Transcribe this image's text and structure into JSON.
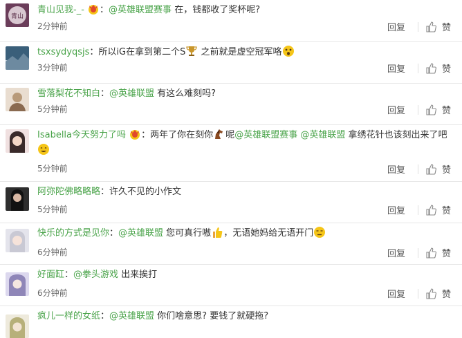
{
  "actions": {
    "reply_label": "回复",
    "like_label": "赞"
  },
  "comments": [
    {
      "user": "青山见我-_-",
      "mention1": "@英雄联盟赛事",
      "text1": " 在，钱都收了奖杯呢?",
      "time": "2分钟前",
      "avatar_color": "#6b3d5a"
    },
    {
      "user": "tsxsydyqsjs",
      "text1": "所以iG在拿到第二个S",
      "text2": " 之前就是虚空冠军咯",
      "time": "3分钟前",
      "avatar_color": "#3a5f7a"
    },
    {
      "user": "雪落梨花不知白",
      "mention1": "@英雄联盟",
      "text1": " 有这么难刻吗?",
      "time": "5分钟前",
      "avatar_color": "#b89a7a"
    },
    {
      "user": "Isabella今天努力了吗",
      "text1": "两年了你在刻你",
      "text2": "呢",
      "mention1": "@英雄联盟赛事",
      "mention2": "@英雄联盟",
      "text3": " 拿绣花针也该刻出来了吧",
      "time": "5分钟前",
      "avatar_color": "#8a5a5a"
    },
    {
      "user": "阿弥陀佛略略略",
      "text1": "许久不见的小作文",
      "time": "5分钟前",
      "avatar_color": "#2e2e2e"
    },
    {
      "user": "快乐的方式是见你",
      "mention1": "@英雄联盟",
      "text1": " 您可真行嗷",
      "text2": "，无语她妈给无语开门",
      "time": "6分钟前",
      "avatar_color": "#c9c9d4"
    },
    {
      "user": "好面缸",
      "mention1": "@拳头游戏",
      "text1": " 出来挨打",
      "time": "6分钟前",
      "avatar_color": "#8f86b8"
    },
    {
      "user": "疯儿一样的女纸",
      "mention1": "@英雄联盟",
      "text1": " 你们啥意思? 要钱了就硬拖?",
      "avatar_color": "#b7b07a"
    }
  ],
  "colors": {
    "username": "#49a349",
    "mention": "#49a349",
    "text": "#333333",
    "time": "#666666"
  }
}
